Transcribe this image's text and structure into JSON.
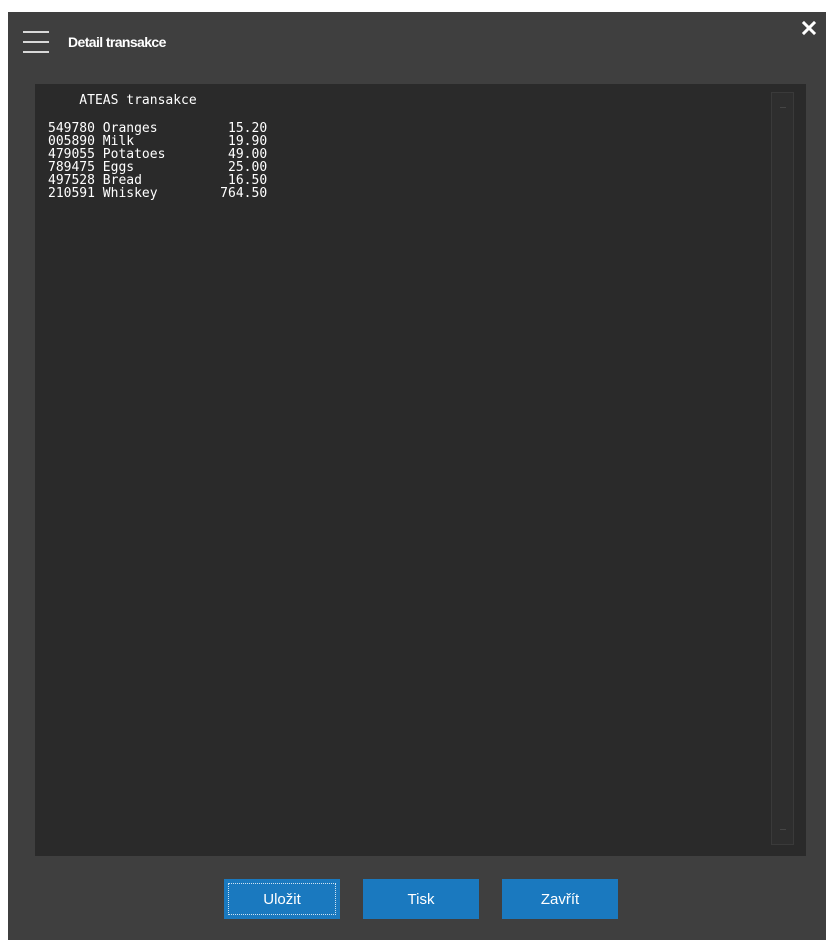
{
  "window": {
    "title": "Detail transakce",
    "menu_icon": "hamburger-menu-icon",
    "close_icon": "close-x-icon"
  },
  "receipt": {
    "heading": "    ATEAS transakce",
    "lines": [
      "549780 Oranges         15.20",
      "005890 Milk            19.90",
      "479055 Potatoes        49.00",
      "789475 Eggs            25.00",
      "497528 Bread           16.50",
      "210591 Whiskey        764.50"
    ]
  },
  "buttons": {
    "save_label": "Uložit",
    "print_label": "Tisk",
    "close_label": "Zavřít"
  },
  "colors": {
    "window_bg": "#3f3f3f",
    "panel_bg": "#2a2a2a",
    "button_bg": "#1a79bf",
    "text": "#ffffff"
  }
}
